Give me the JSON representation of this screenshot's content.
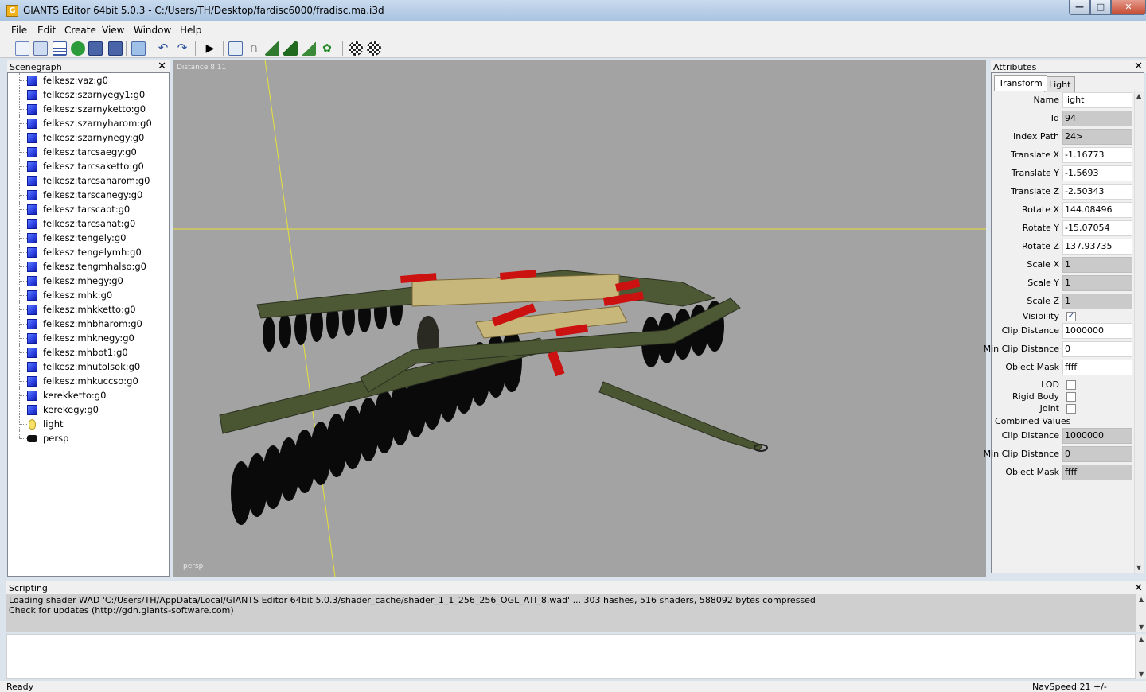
{
  "window": {
    "title": "GIANTS Editor 64bit 5.0.3 - C:/Users/TH/Desktop/fardisc6000/fradisc.ma.i3d",
    "app_icon_letter": "G",
    "min": "—",
    "max": "□",
    "close": "✕"
  },
  "menu": [
    "File",
    "Edit",
    "Create",
    "View",
    "Window",
    "Help"
  ],
  "toolbar": {
    "icons": [
      "new-icon",
      "open-icon",
      "list-icon",
      "refresh-icon",
      "save-icon",
      "save-as-icon",
      "import-icon",
      "undo-icon",
      "redo-icon",
      "play-icon",
      "home-icon",
      "magnet-icon",
      "terrain-edit-icon",
      "terrain-paint-icon",
      "terrain-smooth-icon",
      "foliage-icon",
      "checker-icon",
      "checker-select-icon"
    ]
  },
  "scenegraph": {
    "title": "Scenegraph",
    "close": "✕",
    "items": [
      {
        "label": "felkesz:vaz:g0",
        "type": "shape"
      },
      {
        "label": "felkesz:szarnyegy1:g0",
        "type": "shape"
      },
      {
        "label": "felkesz:szarnyketto:g0",
        "type": "shape"
      },
      {
        "label": "felkesz:szarnyharom:g0",
        "type": "shape"
      },
      {
        "label": "felkesz:szarnynegy:g0",
        "type": "shape"
      },
      {
        "label": "felkesz:tarcsaegy:g0",
        "type": "shape"
      },
      {
        "label": "felkesz:tarcsaketto:g0",
        "type": "shape"
      },
      {
        "label": "felkesz:tarcsaharom:g0",
        "type": "shape"
      },
      {
        "label": "felkesz:tarscanegy:g0",
        "type": "shape"
      },
      {
        "label": "felkesz:tarscaot:g0",
        "type": "shape"
      },
      {
        "label": "felkesz:tarcsahat:g0",
        "type": "shape"
      },
      {
        "label": "felkesz:tengely:g0",
        "type": "shape"
      },
      {
        "label": "felkesz:tengelymh:g0",
        "type": "shape"
      },
      {
        "label": "felkesz:tengmhalso:g0",
        "type": "shape"
      },
      {
        "label": "felkesz:mhegy:g0",
        "type": "shape"
      },
      {
        "label": "felkesz:mhk:g0",
        "type": "shape"
      },
      {
        "label": "felkesz:mhkketto:g0",
        "type": "shape"
      },
      {
        "label": "felkesz:mhbharom:g0",
        "type": "shape"
      },
      {
        "label": "felkesz:mhknegy:g0",
        "type": "shape"
      },
      {
        "label": "felkesz:mhbot1:g0",
        "type": "shape"
      },
      {
        "label": "felkesz:mhutolsok:g0",
        "type": "shape"
      },
      {
        "label": "felkesz:mhkuccso:g0",
        "type": "shape"
      },
      {
        "label": "kerekketto:g0",
        "type": "shape"
      },
      {
        "label": "kerekegy:g0",
        "type": "shape"
      },
      {
        "label": "light",
        "type": "light"
      },
      {
        "label": "persp",
        "type": "camera"
      }
    ]
  },
  "viewport": {
    "distance": "Distance 8.11",
    "camera": "persp"
  },
  "attributes": {
    "title": "Attributes",
    "close": "✕",
    "tabs": [
      "Transform",
      "Light"
    ],
    "fields": [
      {
        "label": "Name",
        "value": "light",
        "ro": false
      },
      {
        "label": "Id",
        "value": "94",
        "ro": true
      },
      {
        "label": "Index Path",
        "value": "24>",
        "ro": true
      },
      {
        "label": "Translate X",
        "value": "-1.16773",
        "ro": false
      },
      {
        "label": "Translate Y",
        "value": "-1.5693",
        "ro": false
      },
      {
        "label": "Translate Z",
        "value": "-2.50343",
        "ro": false
      },
      {
        "label": "Rotate X",
        "value": "144.08496",
        "ro": false
      },
      {
        "label": "Rotate Y",
        "value": "-15.07054",
        "ro": false
      },
      {
        "label": "Rotate Z",
        "value": "137.93735",
        "ro": false
      },
      {
        "label": "Scale X",
        "value": "1",
        "ro": true
      },
      {
        "label": "Scale Y",
        "value": "1",
        "ro": true
      },
      {
        "label": "Scale Z",
        "value": "1",
        "ro": true
      }
    ],
    "visibility": {
      "label": "Visibility",
      "checked": true,
      "mark": "✓"
    },
    "fields2": [
      {
        "label": "Clip Distance",
        "value": "1000000",
        "ro": false
      },
      {
        "label": "Min Clip Distance",
        "value": "0",
        "ro": false
      },
      {
        "label": "Object Mask",
        "value": "ffff",
        "ro": false
      }
    ],
    "checks": [
      {
        "label": "LOD"
      },
      {
        "label": "Rigid Body"
      },
      {
        "label": "Joint"
      }
    ],
    "combined_label": "Combined Values",
    "combined": [
      {
        "label": "Clip Distance",
        "value": "1000000",
        "ro": true
      },
      {
        "label": "Min Clip Distance",
        "value": "0",
        "ro": true
      },
      {
        "label": "Object Mask",
        "value": "ffff",
        "ro": true
      }
    ]
  },
  "scripting": {
    "title": "Scripting",
    "close": "✕",
    "lines": [
      "Loading shader WAD 'C:/Users/TH/AppData/Local/GIANTS Editor 64bit 5.0.3/shader_cache/shader_1_1_256_256_OGL_ATI_8.wad' ... 303 hashes, 516 shaders, 588092 bytes compressed",
      "Check for updates (http://gdn.giants-software.com)"
    ]
  },
  "status": {
    "left": "Ready",
    "right": "NavSpeed 21 +/-"
  }
}
